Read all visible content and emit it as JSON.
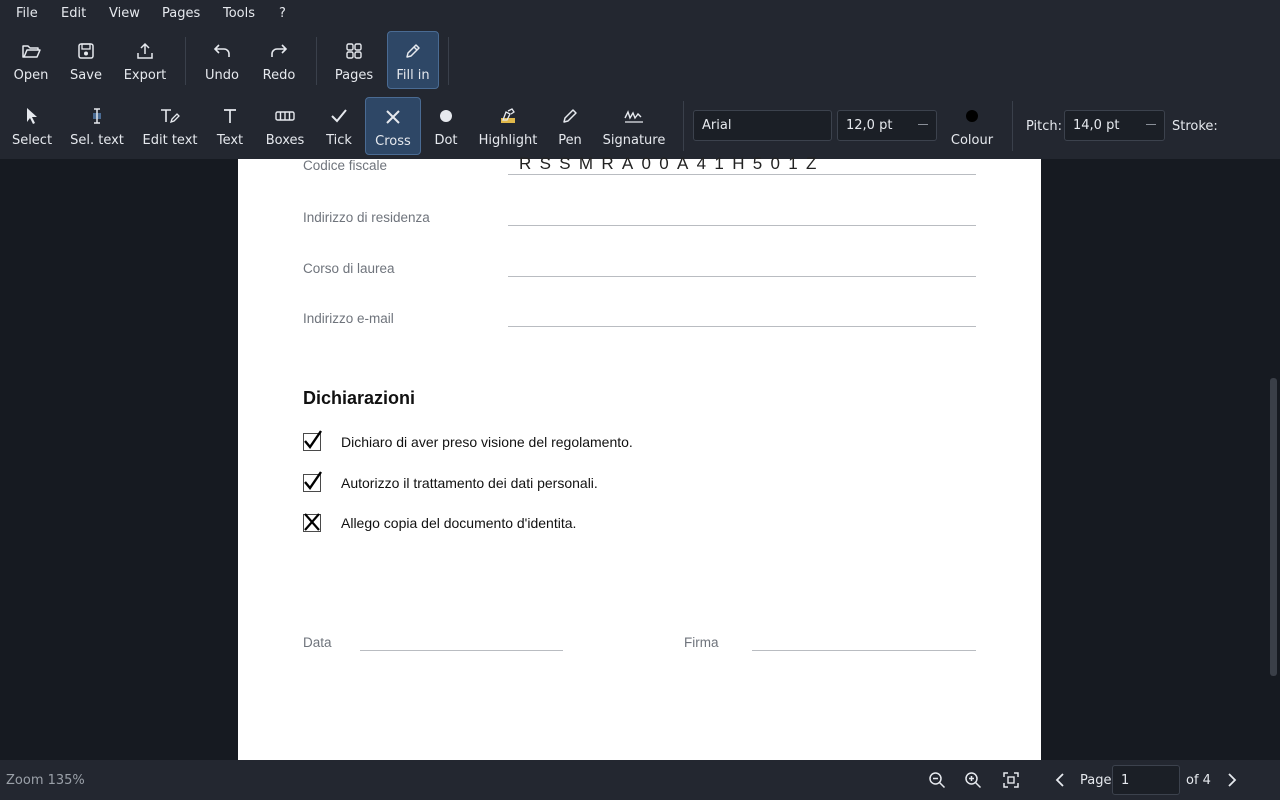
{
  "menu": [
    "File",
    "Edit",
    "View",
    "Pages",
    "Tools",
    "?"
  ],
  "toolbar_top": {
    "open": "Open",
    "save": "Save",
    "export": "Export",
    "undo": "Undo",
    "redo": "Redo",
    "pages": "Pages",
    "fill_in": "Fill in"
  },
  "toolbar_tools": {
    "select": "Select",
    "sel_text": "Sel. text",
    "edit_text": "Edit text",
    "text": "Text",
    "boxes": "Boxes",
    "tick": "Tick",
    "cross": "Cross",
    "dot": "Dot",
    "highlight": "Highlight",
    "pen": "Pen",
    "signature": "Signature",
    "colour": "Colour"
  },
  "font": {
    "family": "Arial",
    "size": "12,0 pt"
  },
  "pitch": {
    "label": "Pitch:",
    "value": "14,0 pt"
  },
  "stroke": {
    "label": "Stroke:"
  },
  "colors": {
    "accent": "#2e4766",
    "highlight_icon": "#e0b84a",
    "colour_swatch": "#000000"
  },
  "document": {
    "fields": [
      {
        "label": "Codice fiscale",
        "value": "RSSMRA00A41H501Z"
      },
      {
        "label": "Indirizzo di residenza",
        "value": ""
      },
      {
        "label": "Corso di laurea",
        "value": ""
      },
      {
        "label": "Indirizzo e-mail",
        "value": ""
      }
    ],
    "heading": "Dichiarazioni",
    "declarations": [
      {
        "text": "Dichiaro di aver preso visione del regolamento.",
        "mark": "tick"
      },
      {
        "text": "Autorizzo il trattamento dei dati personali.",
        "mark": "tick"
      },
      {
        "text": "Allego copia del documento d'identita.",
        "mark": "cross"
      }
    ],
    "date_label": "Data",
    "signature_label": "Firma"
  },
  "status": {
    "zoom": "Zoom 135%",
    "page_label": "Page",
    "page_value": "1",
    "page_of": "of 4"
  }
}
